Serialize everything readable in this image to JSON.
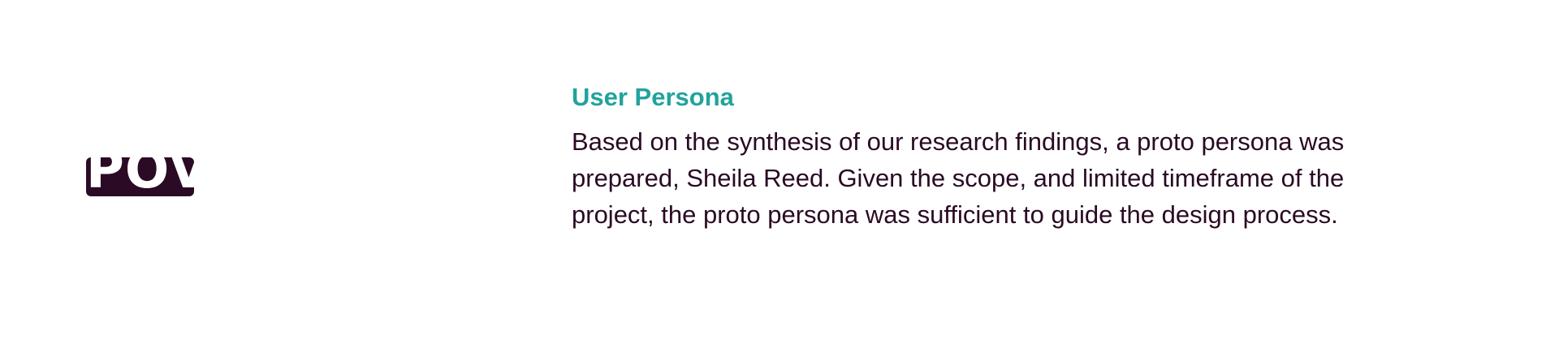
{
  "badge": {
    "label": "POV"
  },
  "section": {
    "title": "User Persona",
    "body": "Based on the synthesis of our research findings, a proto persona was prepared, Sheila Reed. Given the scope, and limited timeframe of the project, the proto persona was sufficient to guide the design process."
  },
  "colors": {
    "accent": "#21a39c",
    "text": "#2a0a24",
    "badge_bg": "#2a0a24",
    "background": "#ffffff"
  }
}
